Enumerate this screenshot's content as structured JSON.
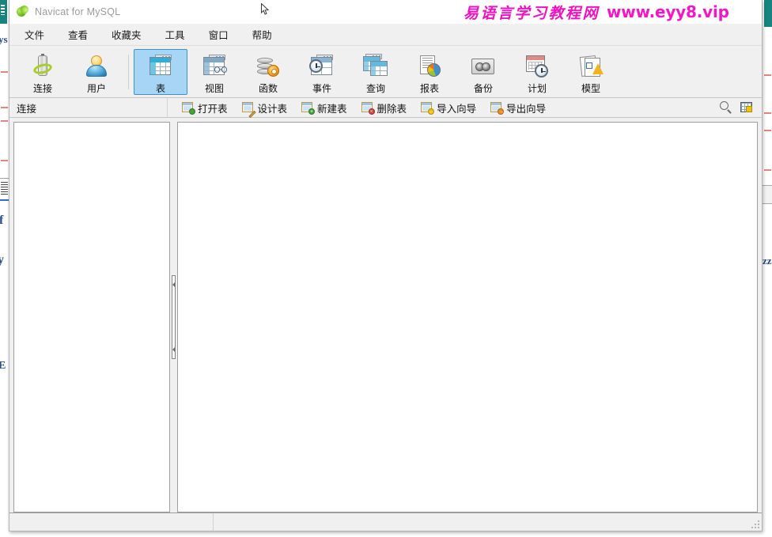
{
  "window": {
    "title": "Navicat for MySQL",
    "logo_icon": "navicat-leaf-logo"
  },
  "watermark": {
    "chinese": "易语言学习教程网",
    "english": "www.eyy8.vip",
    "color": "#ef12c0"
  },
  "menu": {
    "items": [
      {
        "label": "文件",
        "name": "menu-file"
      },
      {
        "label": "查看",
        "name": "menu-view"
      },
      {
        "label": "收藏夹",
        "name": "menu-favorites"
      },
      {
        "label": "工具",
        "name": "menu-tools"
      },
      {
        "label": "窗口",
        "name": "menu-window"
      },
      {
        "label": "帮助",
        "name": "menu-help"
      }
    ]
  },
  "toolbar": {
    "selected": "表",
    "selected_color": "#a6d5f5",
    "buttons": [
      {
        "label": "连接",
        "icon": "connection-icon"
      },
      {
        "label": "用户",
        "icon": "user-icon"
      },
      {
        "label": "表",
        "icon": "table-icon"
      },
      {
        "label": "视图",
        "icon": "view-icon"
      },
      {
        "label": "函数",
        "icon": "function-icon"
      },
      {
        "label": "事件",
        "icon": "event-icon"
      },
      {
        "label": "查询",
        "icon": "query-icon"
      },
      {
        "label": "报表",
        "icon": "report-icon"
      },
      {
        "label": "备份",
        "icon": "backup-icon"
      },
      {
        "label": "计划",
        "icon": "schedule-icon"
      },
      {
        "label": "模型",
        "icon": "model-icon"
      }
    ]
  },
  "subbar": {
    "connection_label": "连接",
    "actions": [
      {
        "label": "打开表",
        "icon": "open-table-icon"
      },
      {
        "label": "设计表",
        "icon": "design-table-icon"
      },
      {
        "label": "新建表",
        "icon": "new-table-icon"
      },
      {
        "label": "删除表",
        "icon": "delete-table-icon"
      },
      {
        "label": "导入向导",
        "icon": "import-wizard-icon"
      },
      {
        "label": "导出向导",
        "icon": "export-wizard-icon"
      }
    ],
    "right_icons": [
      {
        "name": "search-icon"
      },
      {
        "name": "grid-view-icon"
      }
    ]
  },
  "panes": {
    "left": {
      "name": "object-tree-pane",
      "content": ""
    },
    "right": {
      "name": "object-list-pane",
      "content": ""
    },
    "splitter": {
      "name": "pane-splitter"
    }
  },
  "status": {
    "cell1": "",
    "cell2": ""
  }
}
